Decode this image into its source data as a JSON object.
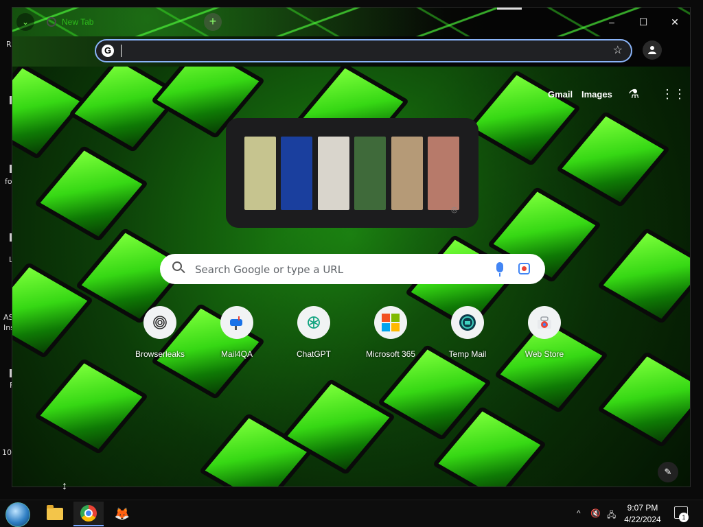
{
  "desktop": {
    "fragments": [
      "R",
      "fo",
      "L",
      "AS",
      "Ins",
      "F",
      "10"
    ]
  },
  "browser": {
    "tab_title": "New Tab",
    "newtab_symbol": "+",
    "controls": {
      "minimize": "–",
      "maximize": "☐",
      "close": "✕"
    },
    "omnibox": {
      "value": "",
      "logo": "G"
    }
  },
  "ntp": {
    "links": {
      "gmail": "Gmail",
      "images": "Images"
    },
    "search_placeholder": "Search Google or type a URL",
    "doodle_colors": [
      "#c6c48f",
      "#1a3f9e",
      "#d9d5cc",
      "#3f6a3a",
      "#b59a77",
      "#b77a6a"
    ],
    "shortcuts": [
      {
        "label": "Browserleaks",
        "icon": "fingerprint-icon"
      },
      {
        "label": "Mail4QA",
        "icon": "mailbox-icon"
      },
      {
        "label": "ChatGPT",
        "icon": "chatgpt-icon"
      },
      {
        "label": "Microsoft 365",
        "icon": "microsoft-icon"
      },
      {
        "label": "Temp Mail",
        "icon": "tempmail-icon"
      },
      {
        "label": "Web Store",
        "icon": "webstore-icon"
      }
    ]
  },
  "taskbar": {
    "time": "9:07 PM",
    "date": "4/22/2024",
    "notification_count": "1"
  }
}
